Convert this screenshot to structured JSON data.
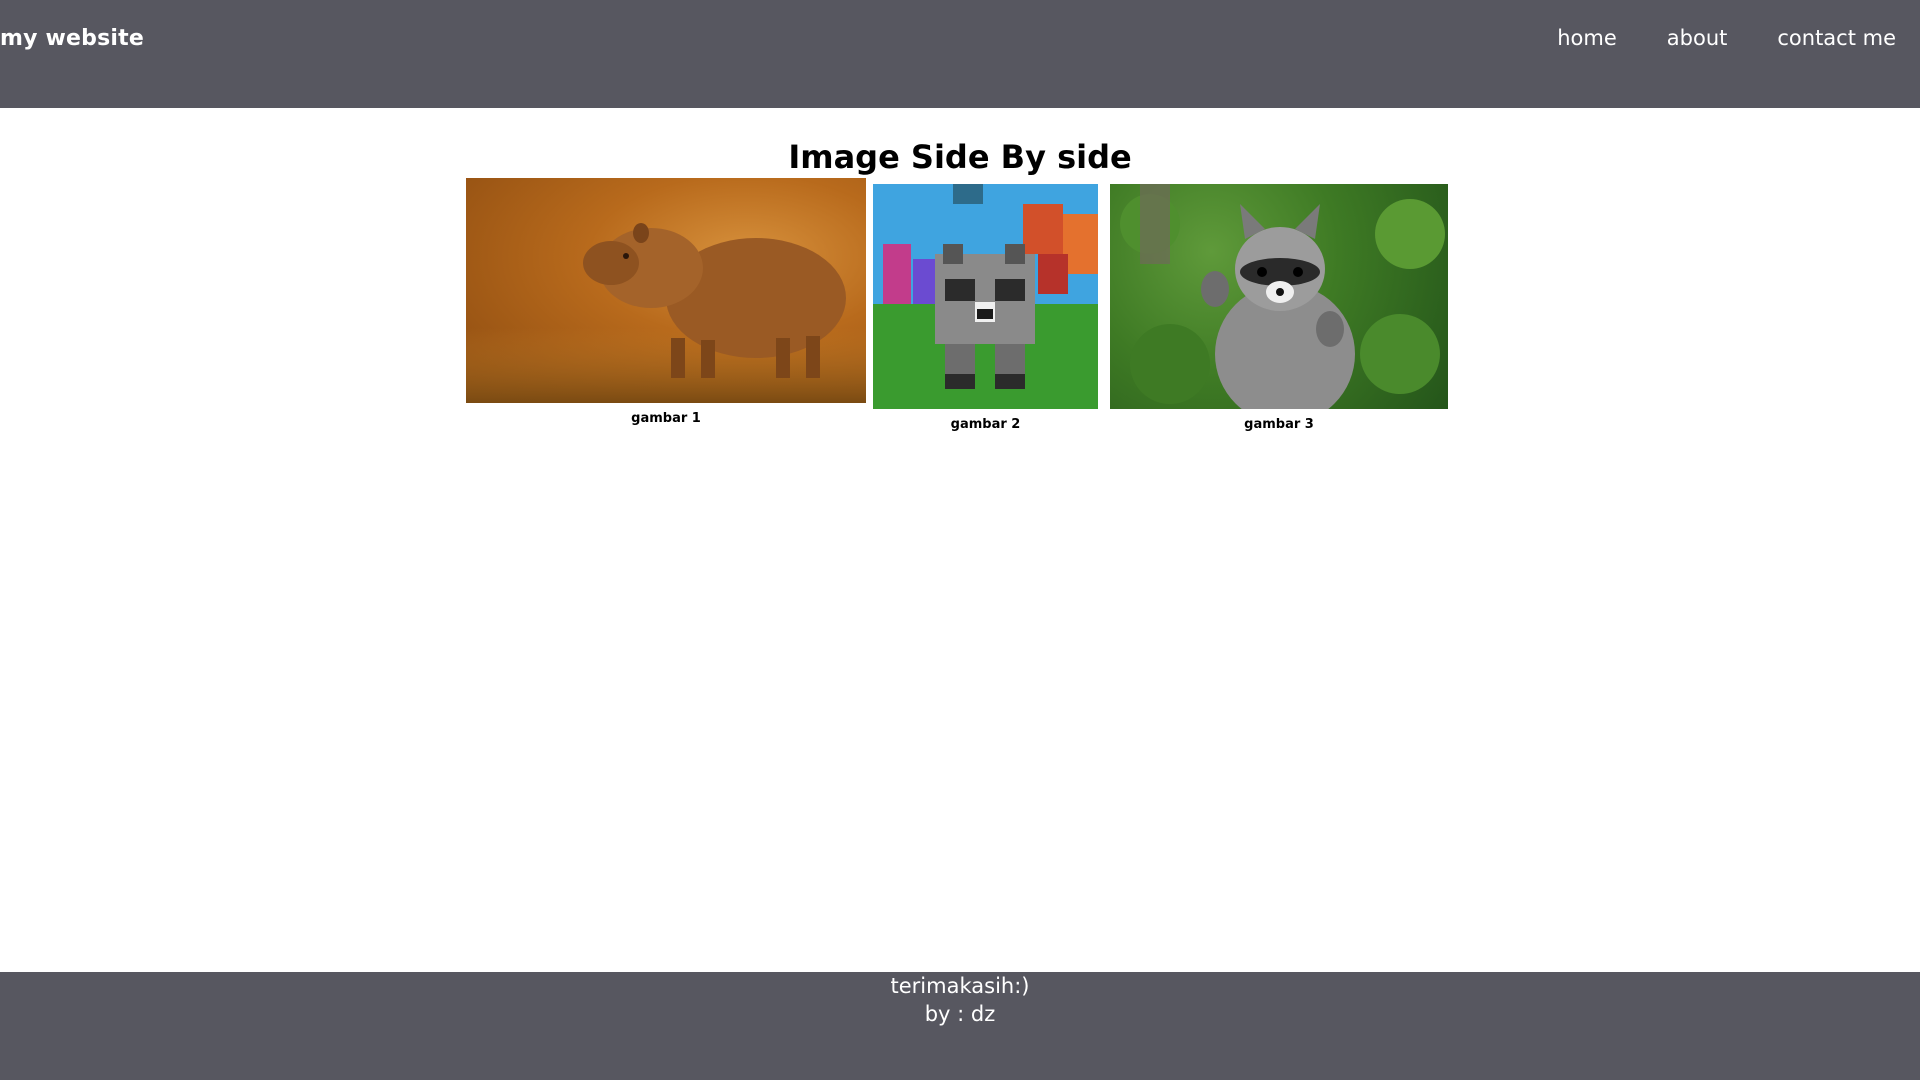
{
  "header": {
    "brand": "my website",
    "nav": [
      {
        "label": "home"
      },
      {
        "label": "about"
      },
      {
        "label": "contact me"
      }
    ]
  },
  "main": {
    "title": "Image Side By side",
    "figures": [
      {
        "caption": "gambar 1",
        "image": "capybara-photo"
      },
      {
        "caption": "gambar 2",
        "image": "minecraft-raccoon-image"
      },
      {
        "caption": "gambar 3",
        "image": "raccoon-photo"
      }
    ]
  },
  "footer": {
    "line1": "terimakasih:)",
    "line2": "by : dz"
  },
  "colors": {
    "bar": "#575760",
    "background": "#ffffff",
    "text_on_bar": "#ffffff"
  }
}
